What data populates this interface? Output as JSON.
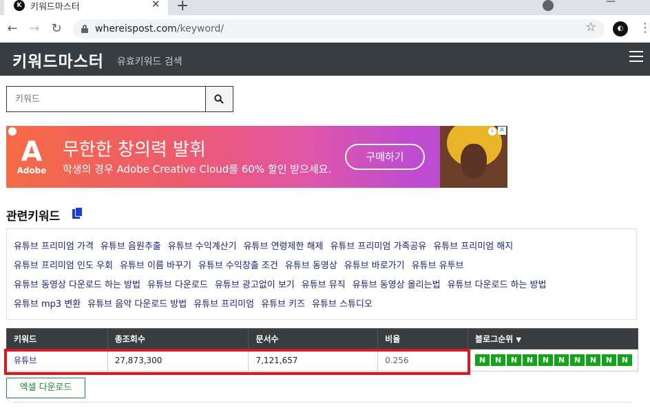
{
  "browser": {
    "tab_title": "키워드마스터",
    "tab_favicon": "K",
    "url_host": "whereispost.com",
    "url_path": "/keyword/"
  },
  "header": {
    "title": "키워드마스터",
    "subtitle": "유효키워드 검색"
  },
  "search": {
    "placeholder": "키워드"
  },
  "ad": {
    "brand": "Adobe",
    "headline": "무한한 창의력 발휘",
    "subtext": "학생의 경우 Adobe Creative Cloud를 60% 할인 받으세요.",
    "cta": "구매하기"
  },
  "related": {
    "title": "관련키워드",
    "rows": [
      [
        "유튜브 프리미엄 가격",
        "유튜브 음원추출",
        "유튜브 수익계산기",
        "유튜브 연령제한 해제",
        "유튜브 프리미엄 가족공유",
        "유튜브 프리미엄 해지"
      ],
      [
        "유튜브 프리미엄 인도 우회",
        "유튜브 이름 바꾸기",
        "유튜브 수익창출 조건",
        "유튜브 동영상",
        "유튜브 바로가기",
        "유튜브 유투브"
      ],
      [
        "유튜브 동영상 다운로드 하는 방법",
        "유튜브 다운로드",
        "유튜브 광고없이 보기",
        "유튜브 뮤직",
        "유튜브 동영상 올리는법",
        "유튜브 다운로드 하는 방법"
      ],
      [
        "유튜브 mp3 변환",
        "유튜브 음악 다운로드 방법",
        "유튜브 프리미엄",
        "유튜브 키즈",
        "유튜브 스튜디오"
      ]
    ]
  },
  "table": {
    "headers": [
      "키워드",
      "총조회수",
      "문서수",
      "비율",
      "블로그순위"
    ],
    "sort_arrow": "▼",
    "row": {
      "keyword": "유튜브",
      "total_views": "27,873,300",
      "documents": "7,121,657",
      "ratio": "0.256",
      "blog_ranks": [
        "N",
        "N",
        "N",
        "N",
        "N",
        "N",
        "N",
        "N",
        "N",
        "N"
      ]
    }
  },
  "excel_button": "엑셀 다운로드",
  "colors": {
    "header_bg": "#383d42",
    "rank_badge": "#12a51a",
    "highlight": "#e0141e",
    "link": "#1a237e"
  }
}
